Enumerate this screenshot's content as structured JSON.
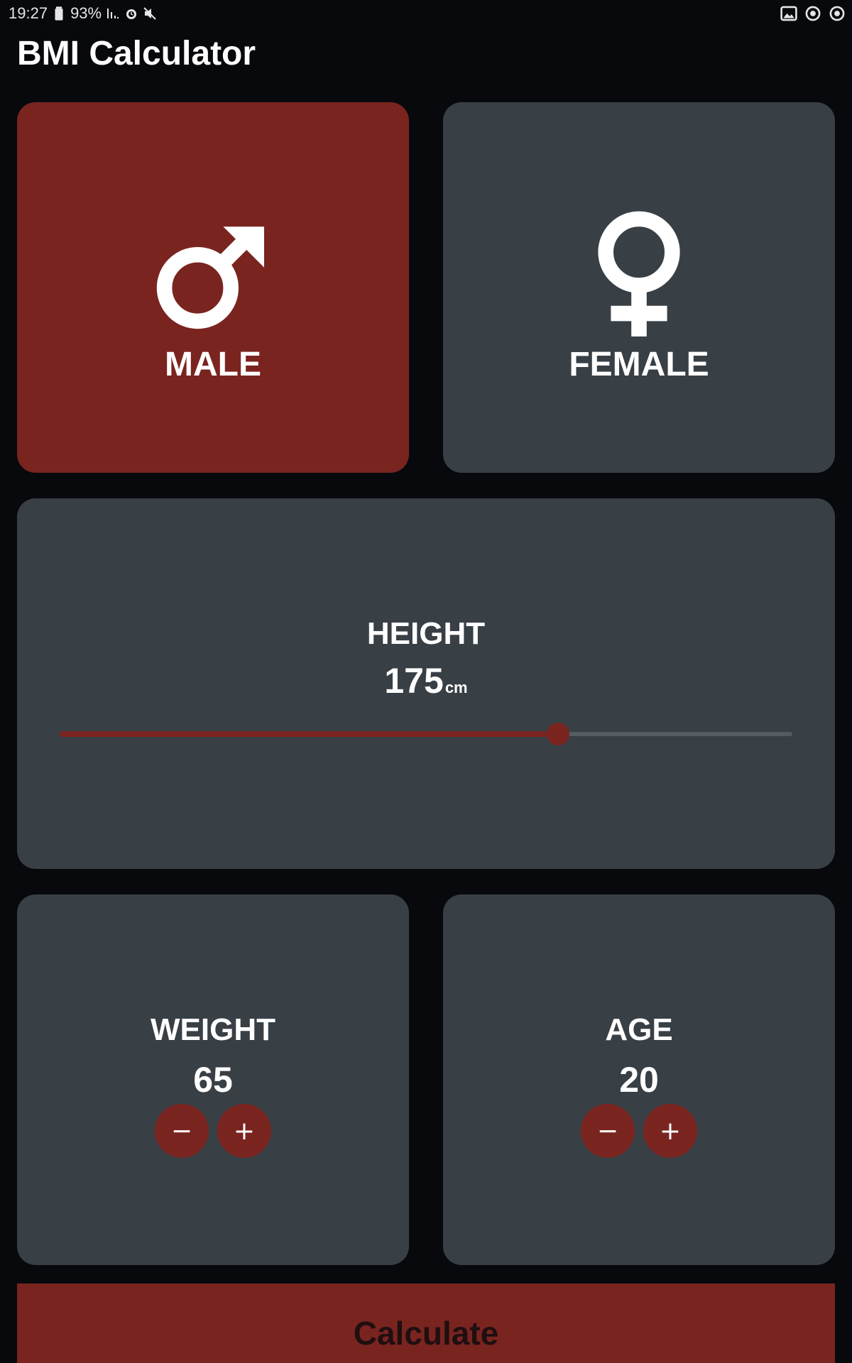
{
  "status_bar": {
    "time": "19:27",
    "battery": "93%",
    "left_icons": [
      "battery-icon",
      "signal-icon",
      "alarm-icon",
      "mute-icon"
    ],
    "right_icons": [
      "image-icon",
      "sync-icon",
      "sync-icon"
    ]
  },
  "app": {
    "title": "BMI Calculator"
  },
  "gender": {
    "selected": "male",
    "male_label": "MALE",
    "female_label": "FEMALE"
  },
  "height": {
    "label": "HEIGHT",
    "value": "175",
    "unit": "cm",
    "slider_fraction": 0.68
  },
  "weight": {
    "label": "WEIGHT",
    "value": "65",
    "minus": "−",
    "plus": "+"
  },
  "age": {
    "label": "AGE",
    "value": "20",
    "minus": "−",
    "plus": "+"
  },
  "calculate_label": "Calculate",
  "colors": {
    "background": "#07090d",
    "card": "#383f45",
    "accent": "#7a2420",
    "text": "#ffffff"
  }
}
